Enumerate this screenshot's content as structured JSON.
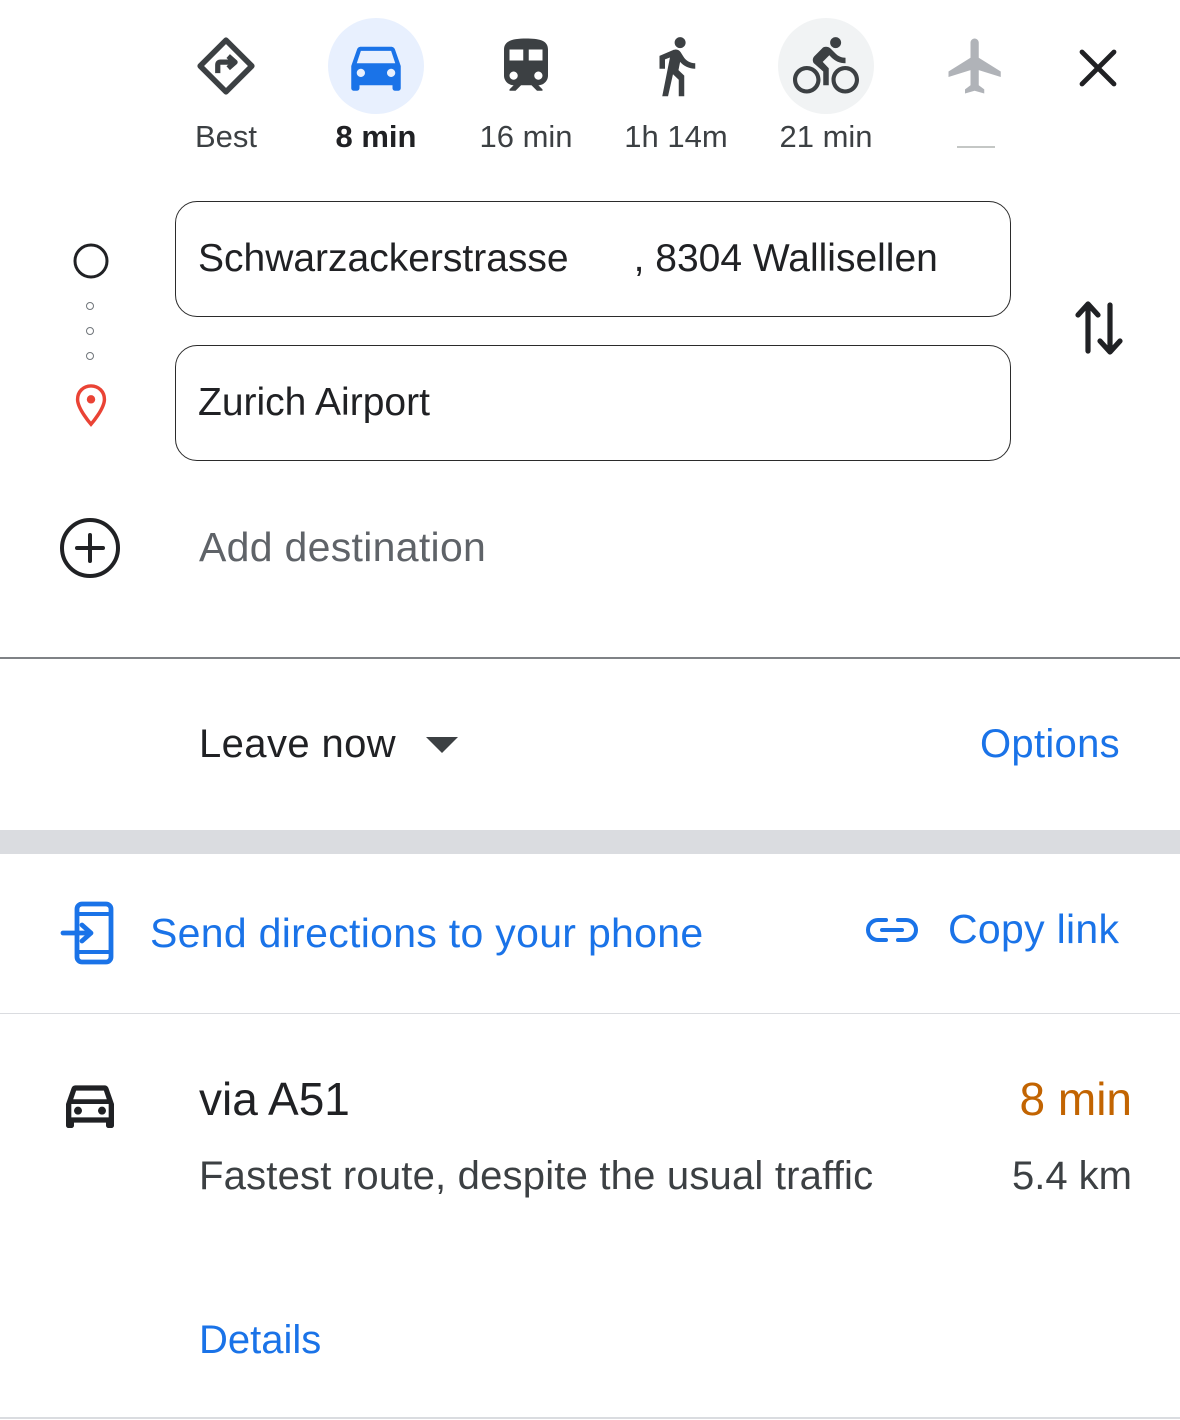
{
  "modes": [
    {
      "key": "best",
      "label": "Best",
      "icon": "directions-icon"
    },
    {
      "key": "driving",
      "label": "8 min",
      "icon": "car-icon",
      "selected": true
    },
    {
      "key": "transit",
      "label": "16 min",
      "icon": "train-icon"
    },
    {
      "key": "walking",
      "label": "1h 14m",
      "icon": "walk-icon"
    },
    {
      "key": "cycling",
      "label": "21 min",
      "icon": "bike-icon"
    },
    {
      "key": "flights",
      "label": "",
      "icon": "airplane-icon"
    }
  ],
  "close_icon": "close-icon",
  "origin": {
    "value": "Schwarzackerstrasse      , 8304 Wallisellen",
    "icon": "origin-circle-icon"
  },
  "destination": {
    "value": "Zurich Airport",
    "icon": "location-pin-icon"
  },
  "swap_icon": "swap-vertical-icon",
  "add_destination": {
    "label": "Add destination",
    "icon": "add-circle-icon"
  },
  "leave": {
    "label": "Leave now",
    "icon": "caret-down-icon"
  },
  "options_label": "Options",
  "share": {
    "send_label": "Send directions to your phone",
    "send_icon": "send-to-phone-icon",
    "copy_label": "Copy link",
    "copy_icon": "link-icon"
  },
  "route": {
    "icon": "car-icon",
    "title": "via A51",
    "time": "8 min",
    "description": "Fastest route, despite the usual traffic",
    "distance": "5.4 km",
    "details_label": "Details"
  },
  "colors": {
    "accent": "#1a73e8",
    "selected_bg": "#e8f0fe",
    "traffic_time": "#c26401",
    "pin_red": "#ea4335"
  }
}
